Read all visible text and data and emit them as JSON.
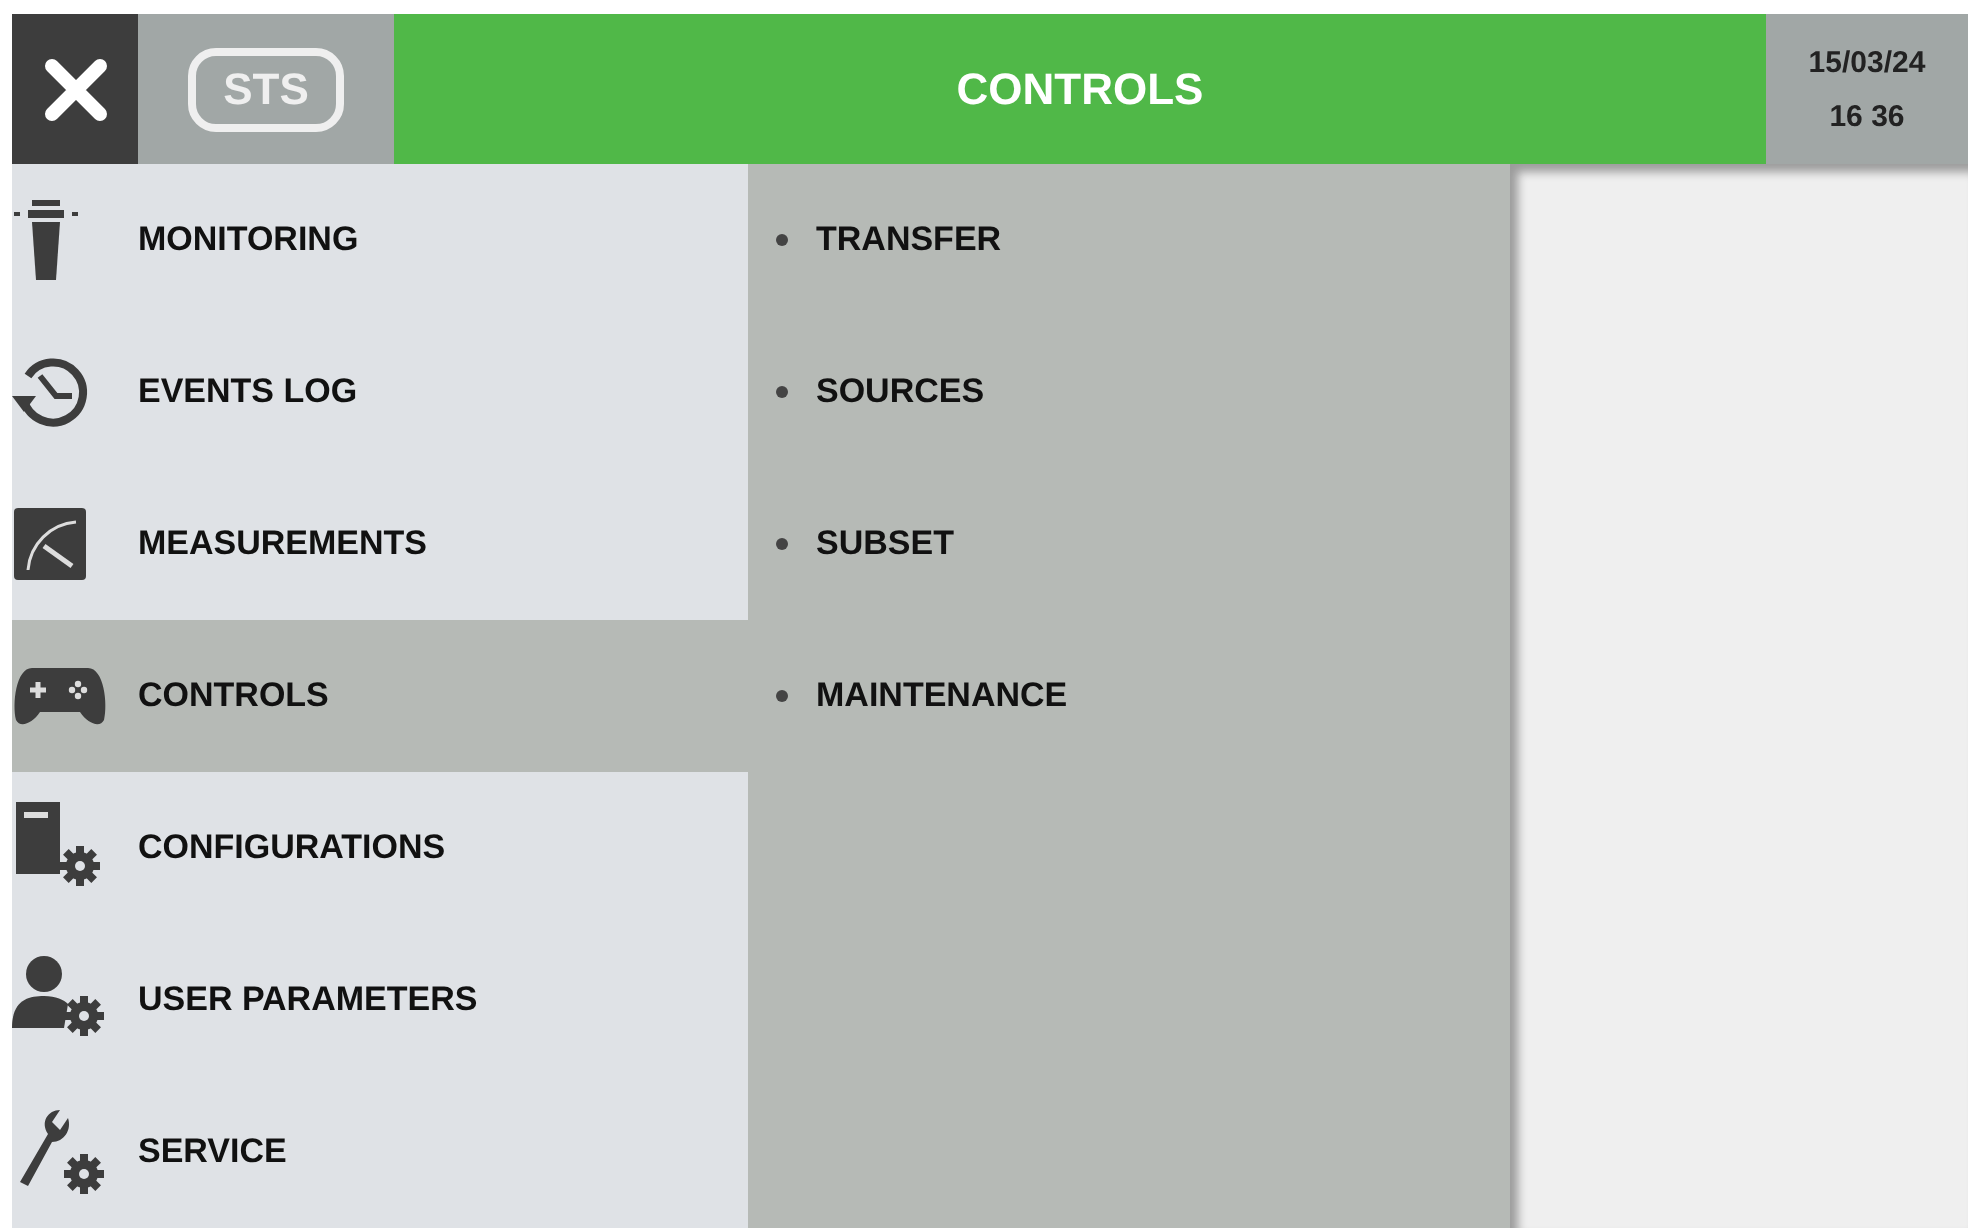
{
  "header": {
    "badge": "STS",
    "title": "CONTROLS",
    "date": "15/03/24",
    "time": "16 36"
  },
  "menu": [
    {
      "label": "MONITORING",
      "kind": "monitoring",
      "selected": false
    },
    {
      "label": "EVENTS LOG",
      "kind": "history",
      "selected": false
    },
    {
      "label": "MEASUREMENTS",
      "kind": "gauge",
      "selected": false
    },
    {
      "label": "CONTROLS",
      "kind": "gamepad",
      "selected": true
    },
    {
      "label": "CONFIGURATIONS",
      "kind": "config",
      "selected": false
    },
    {
      "label": "USER PARAMETERS",
      "kind": "user",
      "selected": false
    },
    {
      "label": "SERVICE",
      "kind": "wrench",
      "selected": false
    }
  ],
  "submenu": [
    "TRANSFER",
    "SOURCES",
    "SUBSET",
    "MAINTENANCE"
  ]
}
